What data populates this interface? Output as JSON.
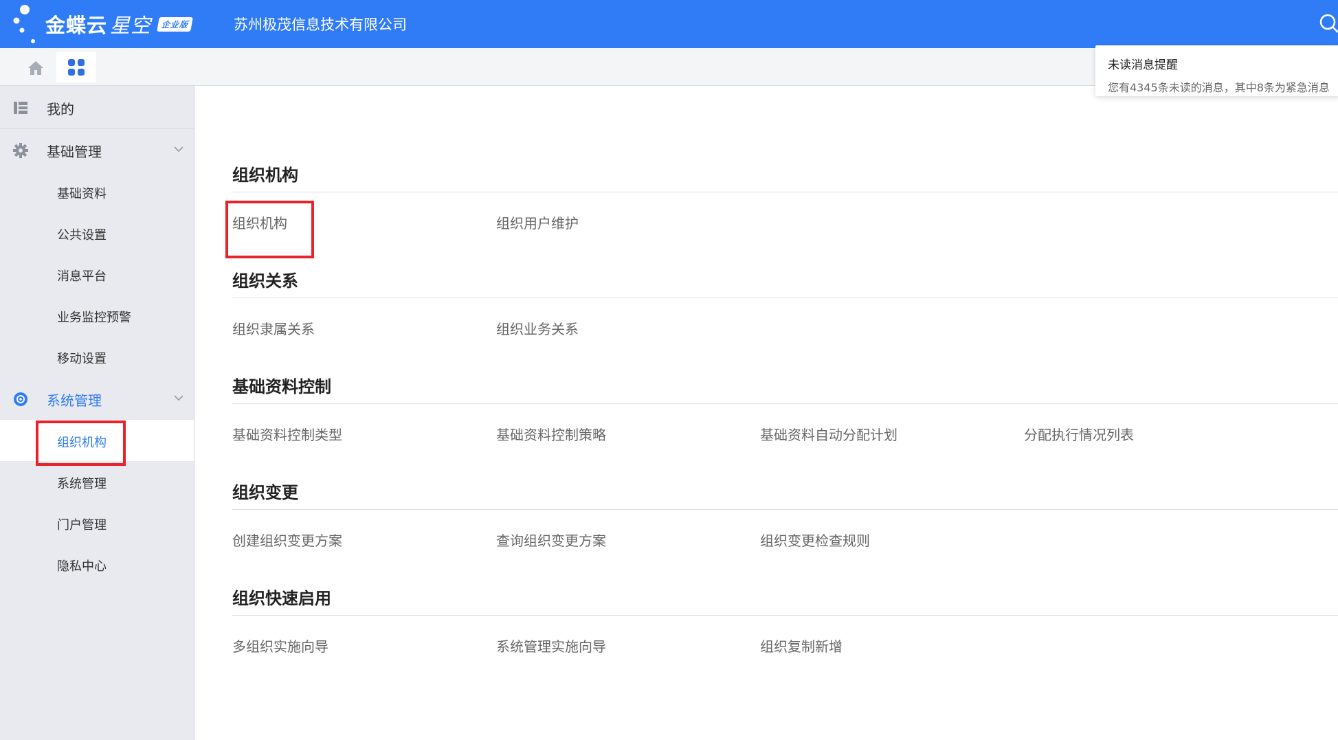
{
  "header": {
    "brand_main": "金蝶云",
    "brand_sub": "星空",
    "edition": "企业版",
    "company": "苏州极茂信息技术有限公司",
    "search_icon": "search-icon"
  },
  "tabs": {
    "home_icon": "home-icon",
    "apps_icon": "grid-apps-icon"
  },
  "notification": {
    "title": "未读消息提醒",
    "text": "您有4345条未读的消息，其中8条为紧急消息"
  },
  "sidebar": {
    "items": [
      {
        "label": "我的",
        "icon": "list-icon"
      },
      {
        "label": "基础管理",
        "icon": "gear-icon"
      },
      {
        "label": "基础资料"
      },
      {
        "label": "公共设置"
      },
      {
        "label": "消息平台"
      },
      {
        "label": "业务监控预警"
      },
      {
        "label": "移动设置"
      },
      {
        "label": "系统管理",
        "icon": "system-icon"
      },
      {
        "label": "组织机构"
      },
      {
        "label": "系统管理"
      },
      {
        "label": "门户管理"
      },
      {
        "label": "隐私中心"
      }
    ],
    "active_color": "#2f7cf6"
  },
  "sections": [
    {
      "title": "组织机构",
      "items": [
        "组织机构",
        "组织用户维护"
      ]
    },
    {
      "title": "组织关系",
      "items": [
        "组织隶属关系",
        "组织业务关系"
      ]
    },
    {
      "title": "基础资料控制",
      "items": [
        "基础资料控制类型",
        "基础资料控制策略",
        "基础资料自动分配计划",
        "分配执行情况列表"
      ]
    },
    {
      "title": "组织变更",
      "items": [
        "创建组织变更方案",
        "查询组织变更方案",
        "组织变更检查规则"
      ]
    },
    {
      "title": "组织快速启用",
      "items": [
        "多组织实施向导",
        "系统管理实施向导",
        "组织复制新增"
      ]
    }
  ],
  "colors": {
    "header_bg": "#2f7cf6",
    "highlight_box": "#e8232b"
  }
}
